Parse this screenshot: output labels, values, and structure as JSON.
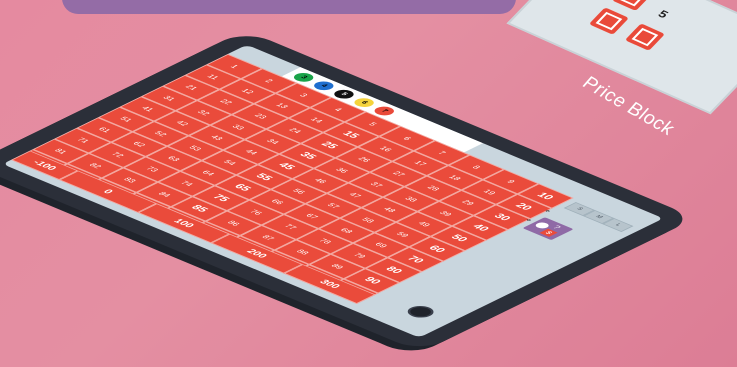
{
  "title": "Price Block",
  "corner": {
    "visible_number": "5"
  },
  "balls": [
    {
      "label": "3",
      "color": "#1aa34a",
      "text_color": "#000000"
    },
    {
      "label": "4",
      "color": "#1f6fcf",
      "text_color": "#000000"
    },
    {
      "label": "5",
      "color": "#111111",
      "text_color": "#ffffff"
    },
    {
      "label": "6",
      "color": "#f5d33c",
      "text_color": "#000000"
    },
    {
      "label": "7",
      "color": "#e94a3a",
      "text_color": "#000000"
    }
  ],
  "grid_numbers": [
    "1",
    "2",
    "3",
    "4",
    "5",
    "6",
    "7",
    "8",
    "9",
    "10",
    "11",
    "12",
    "13",
    "14",
    "15",
    "16",
    "17",
    "18",
    "19",
    "20",
    "21",
    "22",
    "23",
    "24",
    "25",
    "26",
    "27",
    "28",
    "29",
    "30",
    "31",
    "32",
    "33",
    "34",
    "35",
    "36",
    "37",
    "38",
    "39",
    "40",
    "41",
    "42",
    "43",
    "44",
    "45",
    "46",
    "47",
    "48",
    "49",
    "50",
    "51",
    "52",
    "53",
    "54",
    "55",
    "56",
    "57",
    "58",
    "59",
    "60",
    "61",
    "62",
    "63",
    "64",
    "65",
    "66",
    "67",
    "68",
    "69",
    "70",
    "71",
    "72",
    "73",
    "74",
    "75",
    "76",
    "77",
    "78",
    "79",
    "80",
    "81",
    "82",
    "83",
    "84",
    "85",
    "86",
    "87",
    "88",
    "89",
    "90",
    "91",
    "92",
    "93",
    "94",
    "95",
    "96",
    "97",
    "98",
    "99",
    "100"
  ],
  "bottom_buttons": [
    "-100",
    "0",
    "100",
    "200",
    "300"
  ],
  "size_buttons": [
    "S",
    "M",
    "L"
  ],
  "mode_symbols": [
    "+",
    "+",
    "?",
    "$"
  ],
  "colors": {
    "accent": "#ea4b3b",
    "frame": "#2b2f39",
    "screen": "#c9d6de",
    "purple": "#8f6aa6"
  }
}
